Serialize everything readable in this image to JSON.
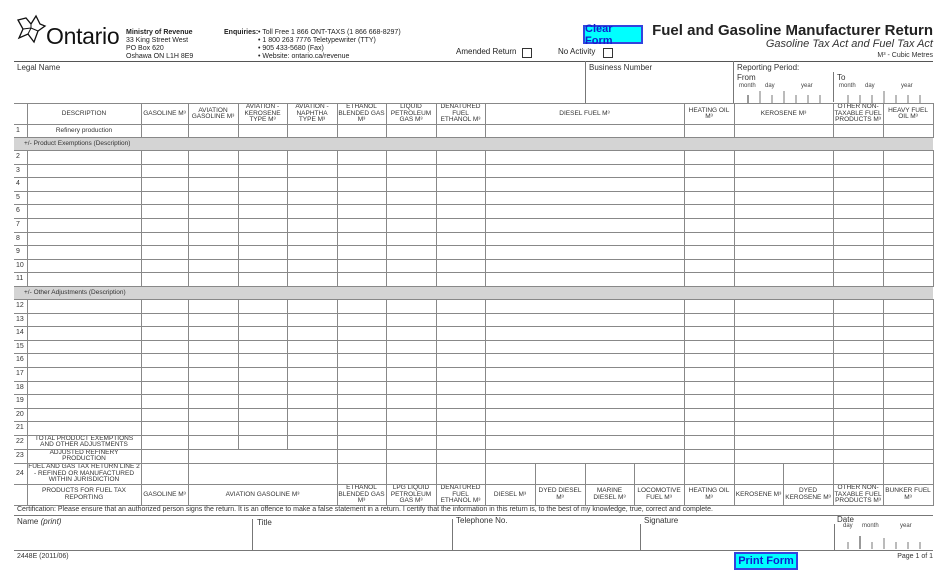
{
  "header": {
    "logo": "Ontario",
    "ministry": {
      "name": "Ministry of Revenue",
      "address": [
        "33 King Street West",
        "PO Box 620",
        "Oshawa ON  L1H 8E9"
      ]
    },
    "enquiries_label": "Enquiries:",
    "enquiries": [
      "• Toll Free 1 866 ONT-TAXS  (1 866 668-8297)",
      "• 1 800 263 7776 Teletypewriter (TTY)",
      "• 905 433-5680 (Fax)",
      "• Website: ontario.ca/revenue"
    ],
    "clear_form_label": "Clear Form",
    "amended_return_label": "Amended Return",
    "no_activity_label": "No Activity",
    "title": "Fuel and Gasoline Manufacturer Return",
    "subtitle": "Gasoline Tax Act and Fuel Tax Act",
    "unit_note": "M³ - Cubic Metres"
  },
  "identity": {
    "legal_name_label": "Legal Name",
    "business_number_label": "Business Number",
    "reporting_period_label": "Reporting Period:",
    "from_label": "From",
    "to_label": "To",
    "month_label": "month",
    "day_label": "day",
    "year_label": "year"
  },
  "table": {
    "header": {
      "description": "DESCRIPTION",
      "gasoline": "GASOLINE M³",
      "aviation_gasoline": "AVIATION GASOLINE M³",
      "aviation_kerosene": "AVIATION - KEROSENE TYPE M³",
      "aviation_naphtha": "AVIATION - NAPHTHA TYPE M³",
      "ethanol_blended": "ETHANOL BLENDED GAS M³",
      "liquid_petroleum": "LIQUID PETROLEUM GAS M³",
      "denatured_ethanol": "DENATURED FUEL ETHANOL M³",
      "diesel_fuel": "DIESEL FUEL M³",
      "heating_oil": "HEATING OIL M³",
      "kerosene": "KEROSENE M³",
      "other_non_taxable": "OTHER NON-TAXABLE FUEL PRODUCTS M³",
      "heavy_fuel_oil": "HEAVY FUEL OIL M³"
    },
    "row1": {
      "num": "1",
      "label": "Refinery production"
    },
    "section_exemptions": "+/- Product Exemptions (Description)",
    "exemption_rows": [
      "2",
      "3",
      "4",
      "5",
      "6",
      "7",
      "8",
      "9",
      "10",
      "11"
    ],
    "section_adjustments": "+/- Other Adjustments (Description)",
    "adjustment_rows": [
      "12",
      "13",
      "14",
      "15",
      "16",
      "17",
      "18",
      "19",
      "20",
      "21"
    ],
    "row22": {
      "num": "22",
      "label": "TOTAL PRODUCT EXEMPTIONS AND OTHER ADJUSTMENTS"
    },
    "row23": {
      "num": "23",
      "label": "ADJUSTED REFINERY PRODUCTION"
    },
    "row24": {
      "num": "24",
      "label": "FUEL AND GAS TAX RETURN LINE 2 - REFINED OR MANUFACTURED WITHIN JURISDICTION"
    },
    "fuel_tax_header": {
      "label": "PRODUCTS FOR FUEL TAX REPORTING",
      "gasoline": "GASOLINE M³",
      "aviation_gasoline": "AVIATION  GASOLINE M³",
      "ethanol_blended": "ETHANOL BLENDED GAS M³",
      "lpg": "LPG   LIQUID PETROLEUM GAS M³",
      "denatured_ethanol": "DENATURED FUEL ETHANOL M³",
      "diesel": "DIESEL M³",
      "dyed_diesel": "DYED DIESEL M³",
      "marine_diesel": "MARINE DIESEL M³",
      "locomotive_fuel": "LOCOMOTIVE FUEL M³",
      "heating_oil": "HEATING OIL M³",
      "kerosene": "KEROSENE M³",
      "dyed_kerosene": "DYED KEROSENE M³",
      "other_non_taxable": "OTHER NON-TAXABLE FUEL PRODUCTS M³",
      "bunker_fuel": "BUNKER FUEL M³"
    }
  },
  "certification": {
    "text": "Certification:  Please ensure that an authorized person signs the return.  It is an offence to make a false statement in a return. I certify that the information in this return is, to the best of my knowledge, true, correct and complete.",
    "name_label": "Name",
    "name_hint": "(print)",
    "title_label": "Title",
    "telephone_label": "Telephone No.",
    "signature_label": "Signature",
    "date_label": "Date",
    "day_label": "day",
    "month_label": "month",
    "year_label": "year"
  },
  "footer": {
    "form_code": "2448E (2011/06)",
    "print_form_label": "Print Form",
    "page_label": "Page 1 of 1"
  }
}
